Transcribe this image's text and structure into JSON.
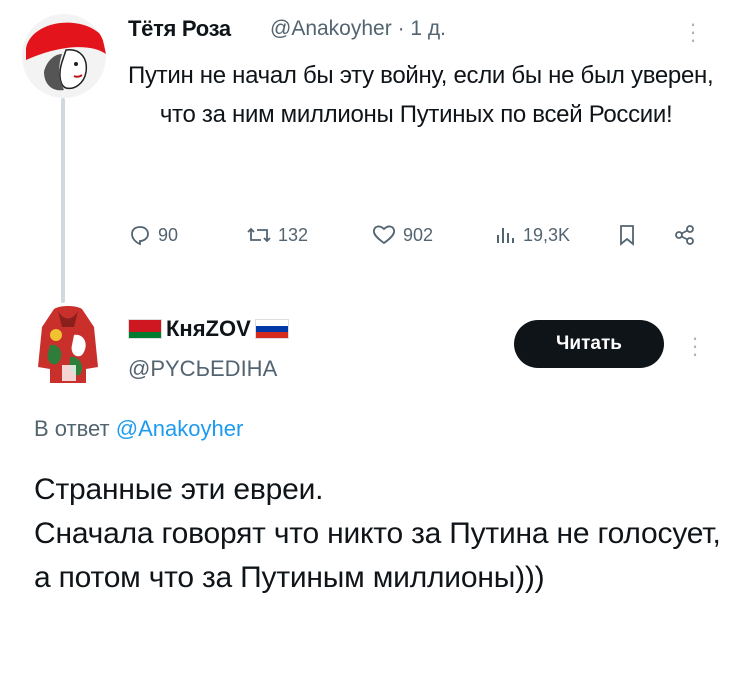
{
  "tweet1": {
    "author_name": "Тётя Роза",
    "handle": "@Anakoyher",
    "separator": "·",
    "time": "1 д.",
    "text": "Путин не начал бы эту войну, если бы не был уверен,\n     что за ним миллионы Путиных по всей России!",
    "actions": {
      "replies": "90",
      "reposts": "132",
      "likes": "902",
      "views": "19,3K"
    }
  },
  "tweet2": {
    "author_name": "КняZOV",
    "handle": "@РYСЬЕDIНА",
    "follow_label": "Читать",
    "reply_to_prefix": "В ответ",
    "reply_to_handle": "@Anakoyher",
    "text": "Странные эти евреи.\nСначала говорят что никто за Путина не голосует, а потом что за Путиным миллионы)))"
  },
  "colors": {
    "text": "#0f1419",
    "muted": "#536471",
    "link": "#1d9bf0",
    "button_bg": "#0f1419",
    "thread_line": "#cfd9de"
  }
}
